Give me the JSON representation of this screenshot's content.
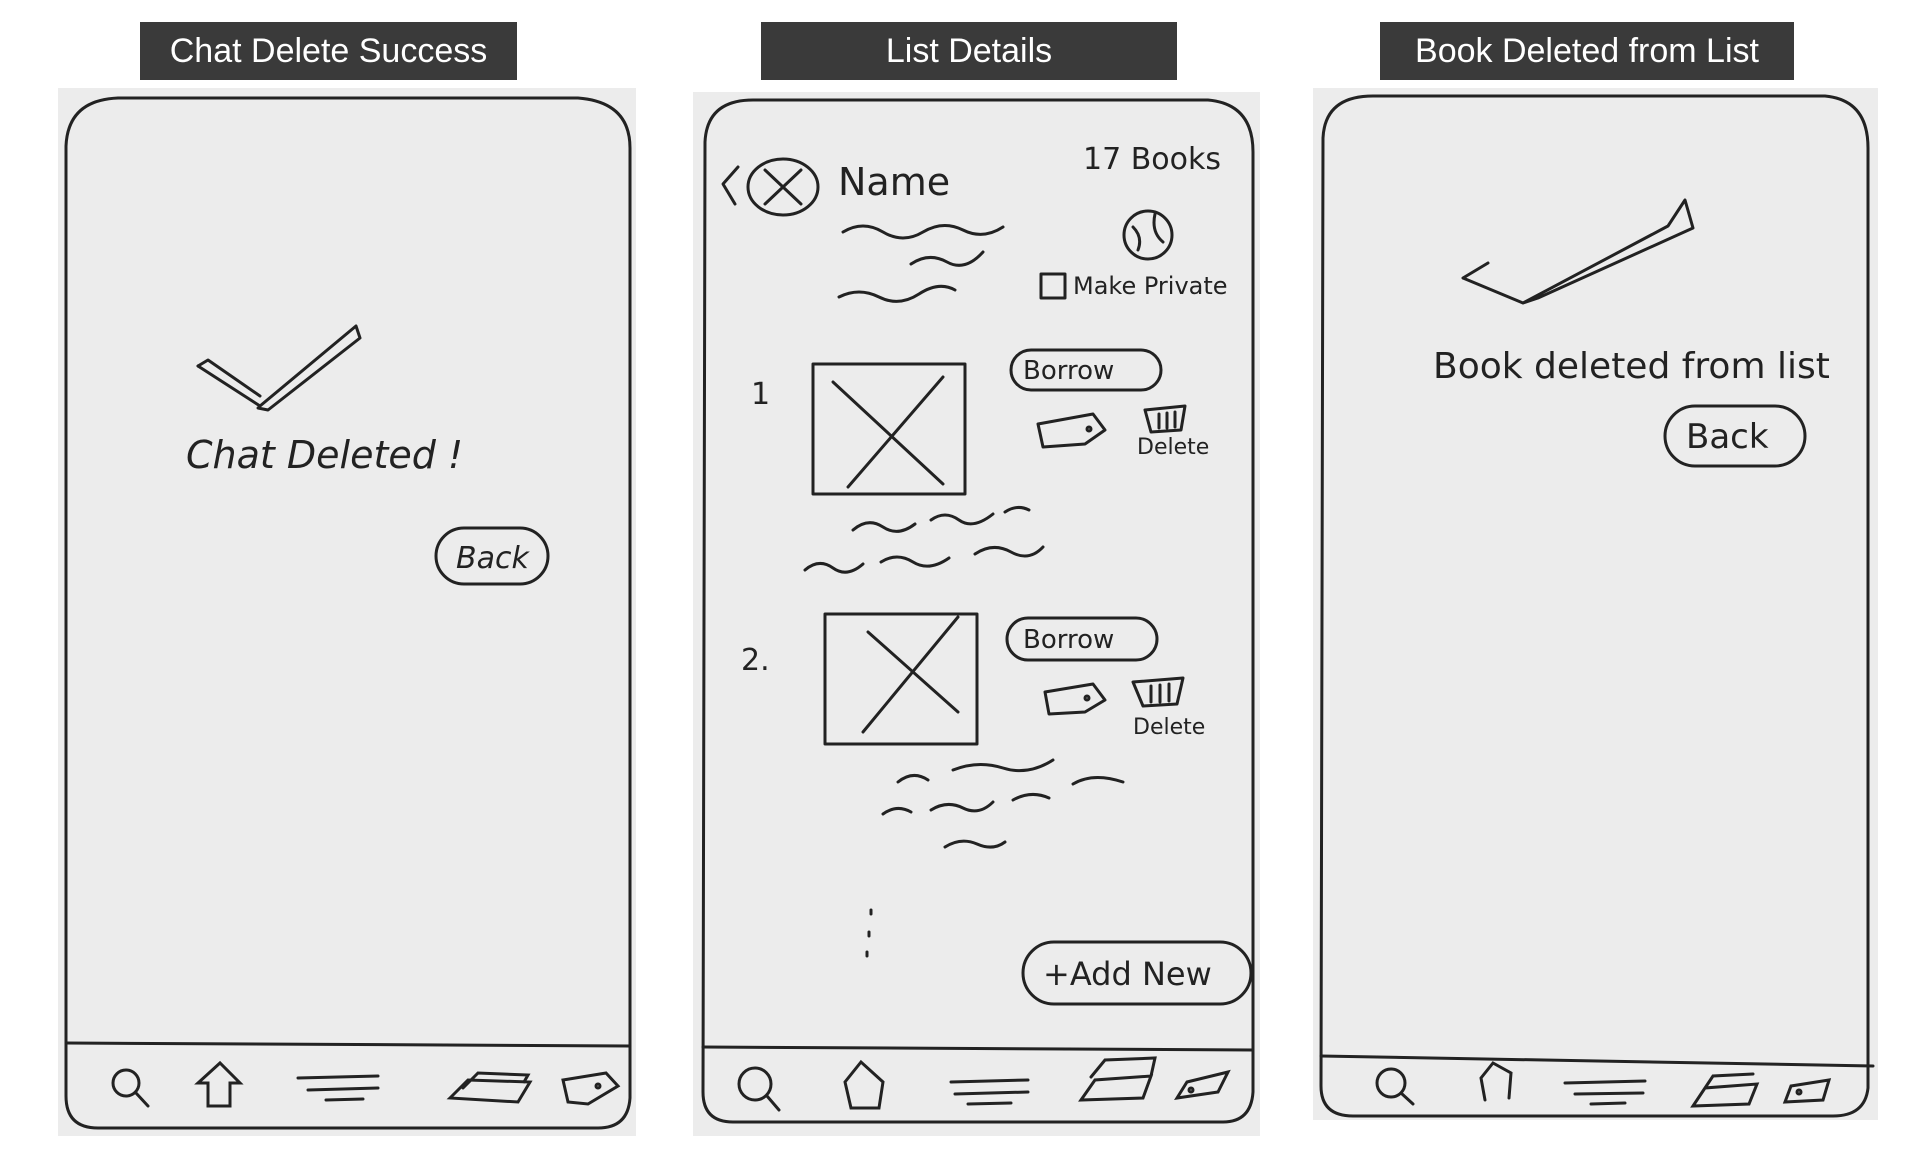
{
  "colors": {
    "title_bar": "#3a3a3a",
    "title_text": "#ffffff",
    "paper": "#ececec",
    "ink": "#222222"
  },
  "panels": [
    {
      "title": "Chat Delete Success",
      "message": "Chat Deleted !",
      "back_label": "Back",
      "nav_icons": [
        "search-icon",
        "home-icon",
        "menu-icon",
        "books-icon",
        "tag-icon"
      ]
    },
    {
      "title": "List Details",
      "header": {
        "name": "Name",
        "count": "17 Books",
        "make_private": "Make Private"
      },
      "items": [
        {
          "number": "1",
          "borrow": "Borrow",
          "delete": "Delete"
        },
        {
          "number": "2.",
          "borrow": "Borrow",
          "delete": "Delete"
        }
      ],
      "add_new": "+Add New",
      "nav_icons": [
        "search-icon",
        "home-icon",
        "menu-icon",
        "books-icon",
        "tag-icon"
      ]
    },
    {
      "title": "Book Deleted from List",
      "message": "Book deleted from list",
      "back_label": "Back",
      "nav_icons": [
        "search-icon",
        "home-icon",
        "menu-icon",
        "books-icon",
        "tag-icon"
      ]
    }
  ]
}
